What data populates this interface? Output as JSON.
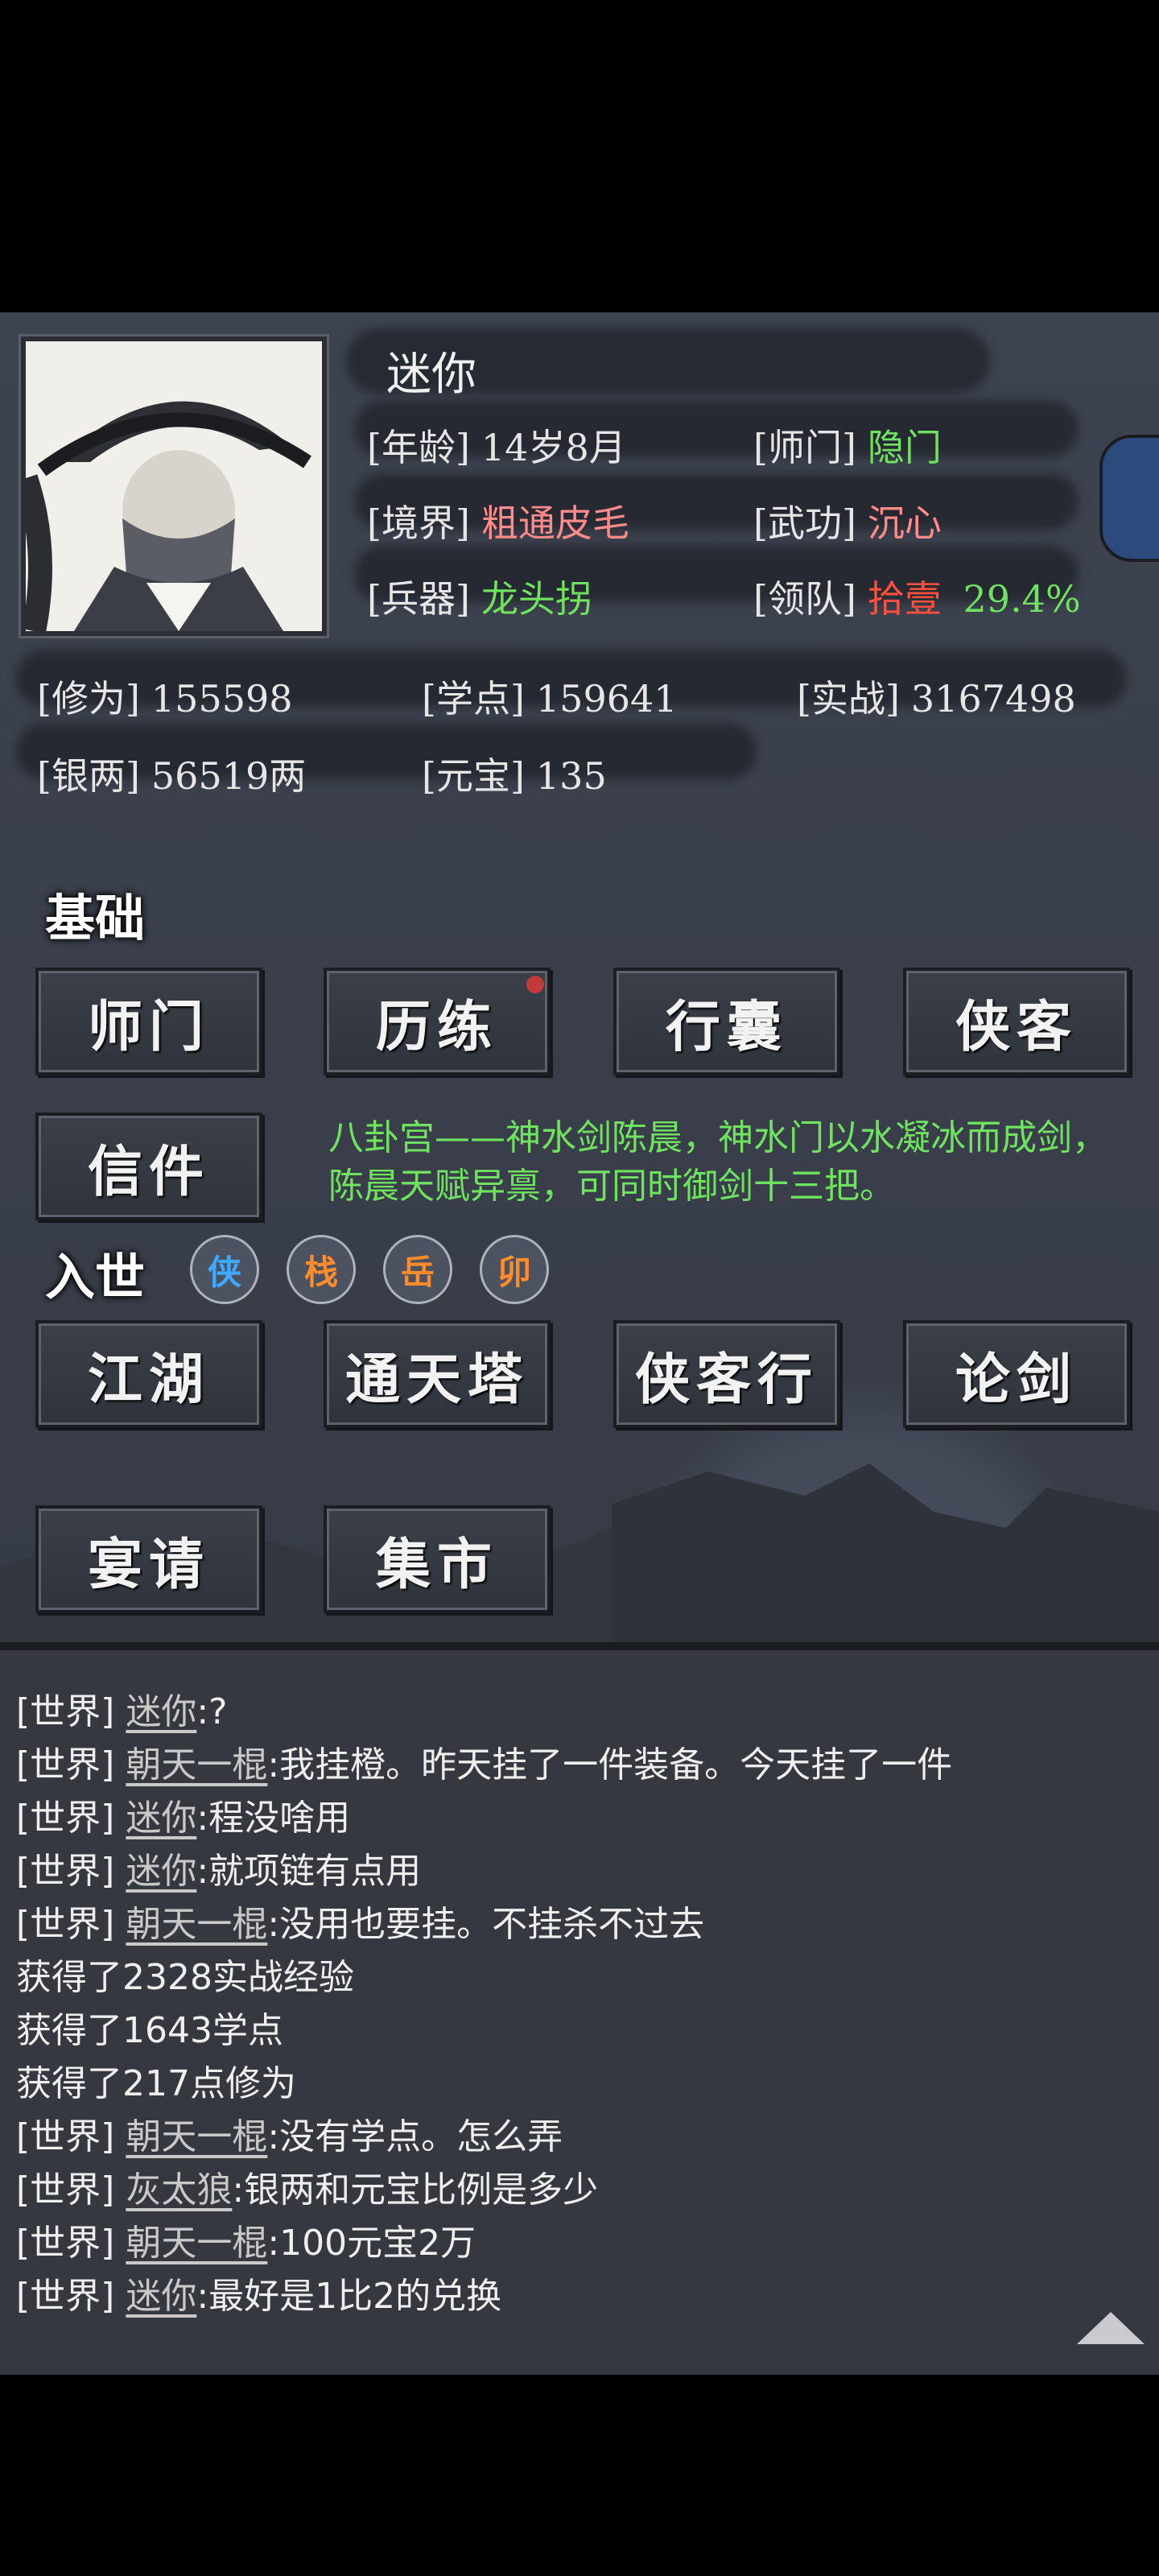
{
  "profile": {
    "name": "迷你",
    "age_label": "[年龄]",
    "age": "14岁8月",
    "school_label": "[师门]",
    "school": "隐门",
    "realm_label": "[境界]",
    "realm": "粗通皮毛",
    "skill_label": "[武功]",
    "skill": "沉心",
    "weapon_label": "[兵器]",
    "weapon": "龙头拐",
    "team_label": "[领队]",
    "team": "拾壹",
    "team_pct": "29.4%"
  },
  "resources": {
    "cultivation_label": "[修为]",
    "cultivation": "155598",
    "study_label": "[学点]",
    "study": "159641",
    "combat_label": "[实战]",
    "combat": "3167498",
    "silver_label": "[银两]",
    "silver": "56519两",
    "ingot_label": "[元宝]",
    "ingot": "135"
  },
  "basics": {
    "title": "基础",
    "buttons": [
      "师门",
      "历练",
      "行囊",
      "侠客",
      "信件"
    ],
    "notice": "八卦宫——神水剑陈晨，神水门以水凝冰而成剑，陈晨天赋异禀，可同时御剑十三把。"
  },
  "world": {
    "title": "入世",
    "seals": [
      "侠",
      "栈",
      "岳",
      "卯"
    ],
    "buttons": [
      "江湖",
      "通天塔",
      "侠客行",
      "论剑",
      "宴请",
      "集市"
    ]
  },
  "chat": [
    {
      "tag": "[世界]",
      "name": "迷你",
      "msg": ":?"
    },
    {
      "tag": "[世界]",
      "name": "朝天一棍",
      "msg": ":我挂橙。昨天挂了一件装备。今天挂了一件"
    },
    {
      "tag": "[世界]",
      "name": "迷你",
      "msg": ":程没啥用"
    },
    {
      "tag": "[世界]",
      "name": "迷你",
      "msg": ":就项链有点用"
    },
    {
      "tag": "[世界]",
      "name": "朝天一棍",
      "msg": ":没用也要挂。不挂杀不过去"
    },
    {
      "tag": "",
      "name": "",
      "msg": "获得了2328实战经验"
    },
    {
      "tag": "",
      "name": "",
      "msg": "获得了1643学点"
    },
    {
      "tag": "",
      "name": "",
      "msg": "获得了217点修为"
    },
    {
      "tag": "[世界]",
      "name": "朝天一棍",
      "msg": ":没有学点。怎么弄"
    },
    {
      "tag": "[世界]",
      "name": "灰太狼",
      "msg": ":银两和元宝比例是多少"
    },
    {
      "tag": "[世界]",
      "name": "朝天一棍",
      "msg": ":100元宝2万"
    },
    {
      "tag": "[世界]",
      "name": "迷你",
      "msg": ":最好是1比2的兑换"
    }
  ],
  "colors": {
    "green": "#6fe35f",
    "red": "#ff8a8a",
    "accent_red": "#ff4f3f"
  },
  "icons": {
    "scroll_up": "triangle-up-icon",
    "side_tab": "book-icon"
  }
}
